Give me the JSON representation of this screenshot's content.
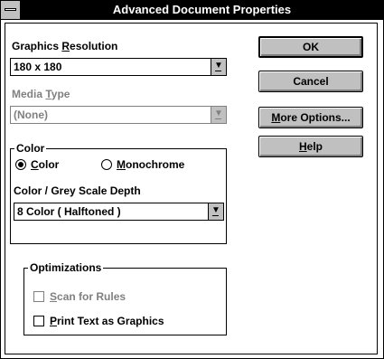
{
  "window": {
    "title": "Advanced Document Properties"
  },
  "graphics_resolution": {
    "label_pre": "Graphics ",
    "label_key": "R",
    "label_post": "esolution",
    "value": "180 x 180"
  },
  "media_type": {
    "label_pre": "Media ",
    "label_key": "T",
    "label_post": "ype",
    "value": "(None)",
    "enabled": false
  },
  "color_group": {
    "legend": "Color",
    "radio_color": {
      "key": "C",
      "rest": "olor",
      "selected": true
    },
    "radio_mono": {
      "key": "M",
      "rest": "onochrome",
      "selected": false
    },
    "depth_label": "Color / Grey Scale Depth",
    "depth_value": "8 Color ( Halftoned )"
  },
  "optimizations": {
    "legend": "Optimizations",
    "scan": {
      "key": "S",
      "rest": "can for Rules",
      "checked": false,
      "enabled": false
    },
    "print_text": {
      "key": "P",
      "rest": "rint Text as Graphics",
      "checked": false
    }
  },
  "buttons": {
    "ok": "OK",
    "cancel": "Cancel",
    "more_pre": "",
    "more_key": "M",
    "more_post": "ore Options...",
    "help_key": "H",
    "help_post": "elp"
  },
  "icons": {
    "dropdown": "down-arrow-underline-icon",
    "system_menu": "system-menu-icon"
  },
  "colors": {
    "titlebar": "#000000",
    "button_face": "#c0c0c0",
    "disabled_text": "#808080"
  }
}
